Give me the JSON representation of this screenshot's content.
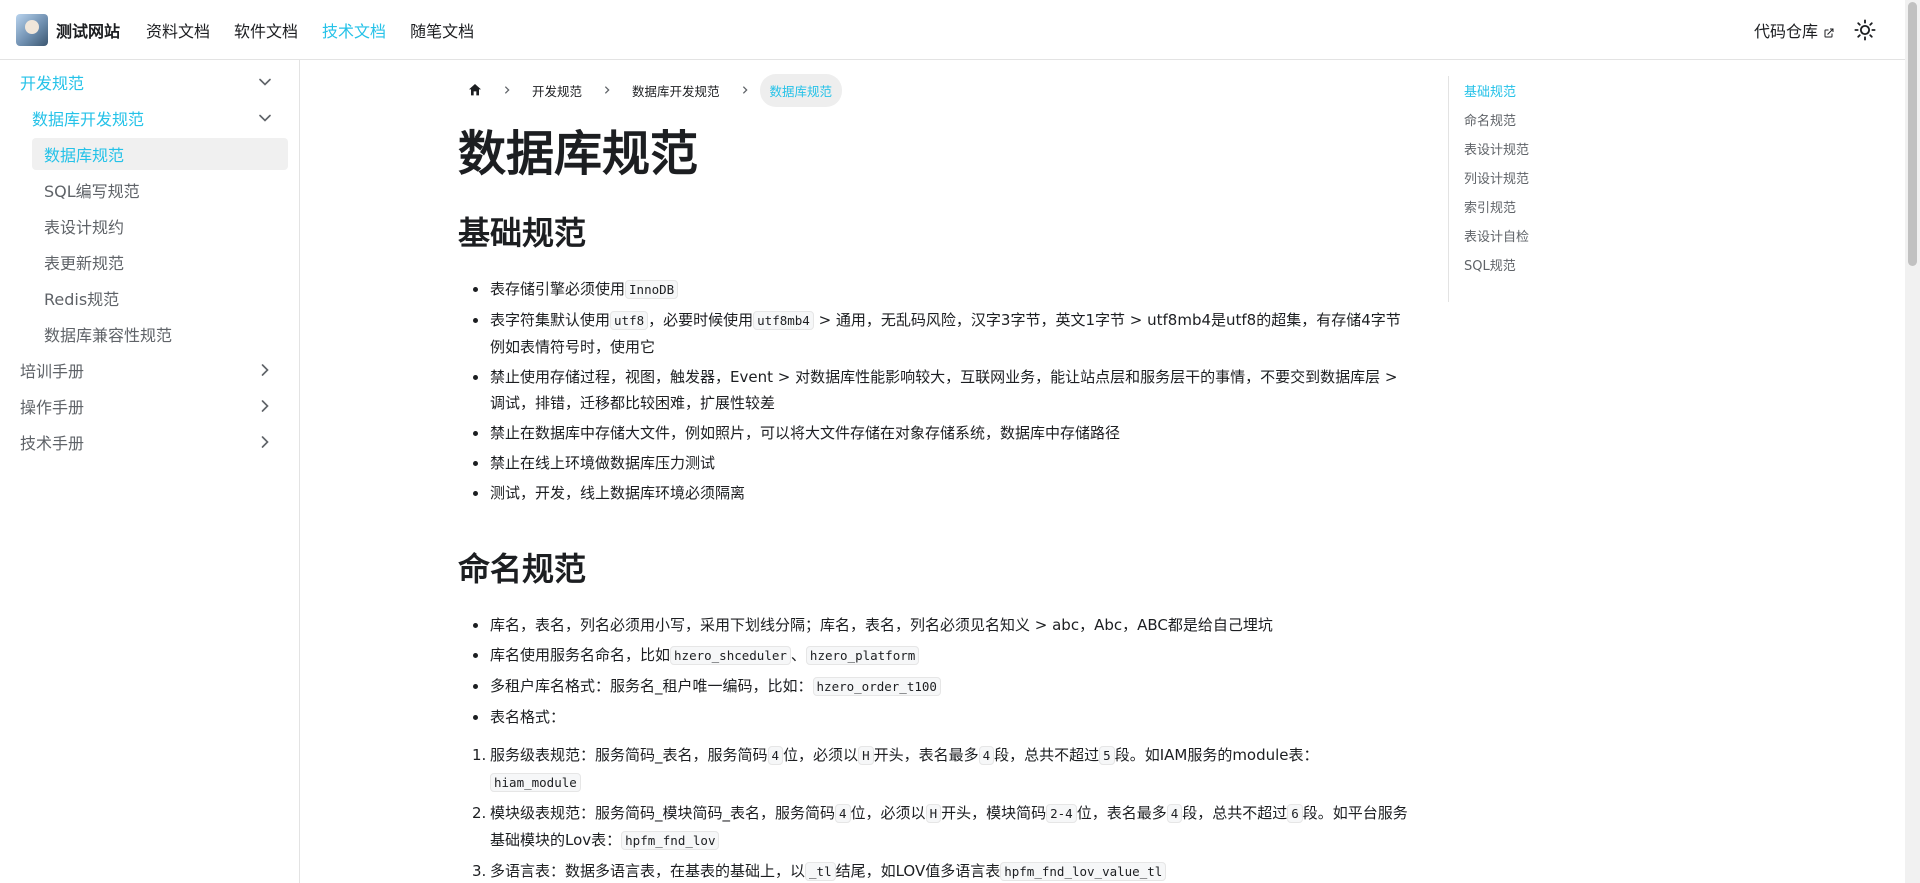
{
  "navbar": {
    "brand": "测试网站",
    "links": [
      "资料文档",
      "软件文档",
      "技术文档",
      "随笔文档"
    ],
    "repo_label": "代码仓库"
  },
  "sidebar": {
    "dev_spec": "开发规范",
    "db_dev_spec": "数据库开发规范",
    "items": [
      "数据库规范",
      "SQL编写规范",
      "表设计规约",
      "表更新规范",
      "Redis规范",
      "数据库兼容性规范"
    ],
    "groups": [
      "培训手册",
      "操作手册",
      "技术手册"
    ]
  },
  "breadcrumbs": [
    "开发规范",
    "数据库开发规范",
    "数据库规范"
  ],
  "page": {
    "title": "数据库规范",
    "section1": {
      "title": "基础规范",
      "b1": {
        "pre": "表存储引擎必须使用",
        "code": "InnoDB"
      },
      "b2": {
        "pre": "表字符集默认使用",
        "code1": "utf8",
        "mid": "，必要时候使用",
        "code2": "utf8mb4",
        "post": " > 通用，无乱码风险，汉字3字节，英文1字节 > utf8mb4是utf8的超集，有存储4字节例如表情符号时，使用它"
      },
      "b3": "禁止使用存储过程，视图，触发器，Event > 对数据库性能影响较大，互联网业务，能让站点层和服务层干的事情，不要交到数据库层 > 调试，排错，迁移都比较困难，扩展性较差",
      "b4": "禁止在数据库中存储大文件，例如照片，可以将大文件存储在对象存储系统，数据库中存储路径",
      "b5": "禁止在线上环境做数据库压力测试",
      "b6": "测试，开发，线上数据库环境必须隔离"
    },
    "section2": {
      "title": "命名规范",
      "b1": "库名，表名，列名必须用小写，采用下划线分隔；库名，表名，列名必须见名知义 > abc，Abc，ABC都是给自己埋坑",
      "b2": {
        "pre": "库名使用服务名命名，比如",
        "code1": "hzero_shceduler",
        "mid": "、",
        "code2": "hzero_platform"
      },
      "b3": {
        "pre": "多租户库名格式：服务名_租户唯一编码，比如：",
        "code": "hzero_order_t100"
      },
      "b4": "表名格式：",
      "n1": {
        "num": "1.",
        "a": "服务级表规范：服务简码_表名，服务简码",
        "c1": "4",
        "b": "位，必须以",
        "c2": "H",
        "c": "开头，表名最多",
        "c3": "4",
        "d": "段，总共不超过",
        "c4": "5",
        "e": "段。如IAM服务的module表：",
        "c5": "hiam_module"
      },
      "n2": {
        "num": "2.",
        "a": "模块级表规范：服务简码_模块简码_表名，服务简码",
        "c1": "4",
        "b": "位，必须以",
        "c2": "H",
        "c": "开头，模块简码",
        "c3": "2-4",
        "d": "位，表名最多",
        "c4": "4",
        "e": "段，总共不超过",
        "c5": "6",
        "f": "段。如平台服务基础模块的Lov表：",
        "c6": "hpfm_fnd_lov"
      },
      "n3": {
        "num": "3.",
        "a": "多语言表：数据多语言表，在基表的基础上，以",
        "c1": "_tl",
        "b": "结尾，如LOV值多语言表",
        "c2": "hpfm_fnd_lov_value_tl"
      }
    }
  },
  "toc": [
    "基础规范",
    "命名规范",
    "表设计规范",
    "列设计规范",
    "索引规范",
    "表设计自检",
    "SQL规范"
  ],
  "colors": {
    "accent": "#25c2e8",
    "text": "#1c1e21",
    "muted": "#5f6368"
  }
}
